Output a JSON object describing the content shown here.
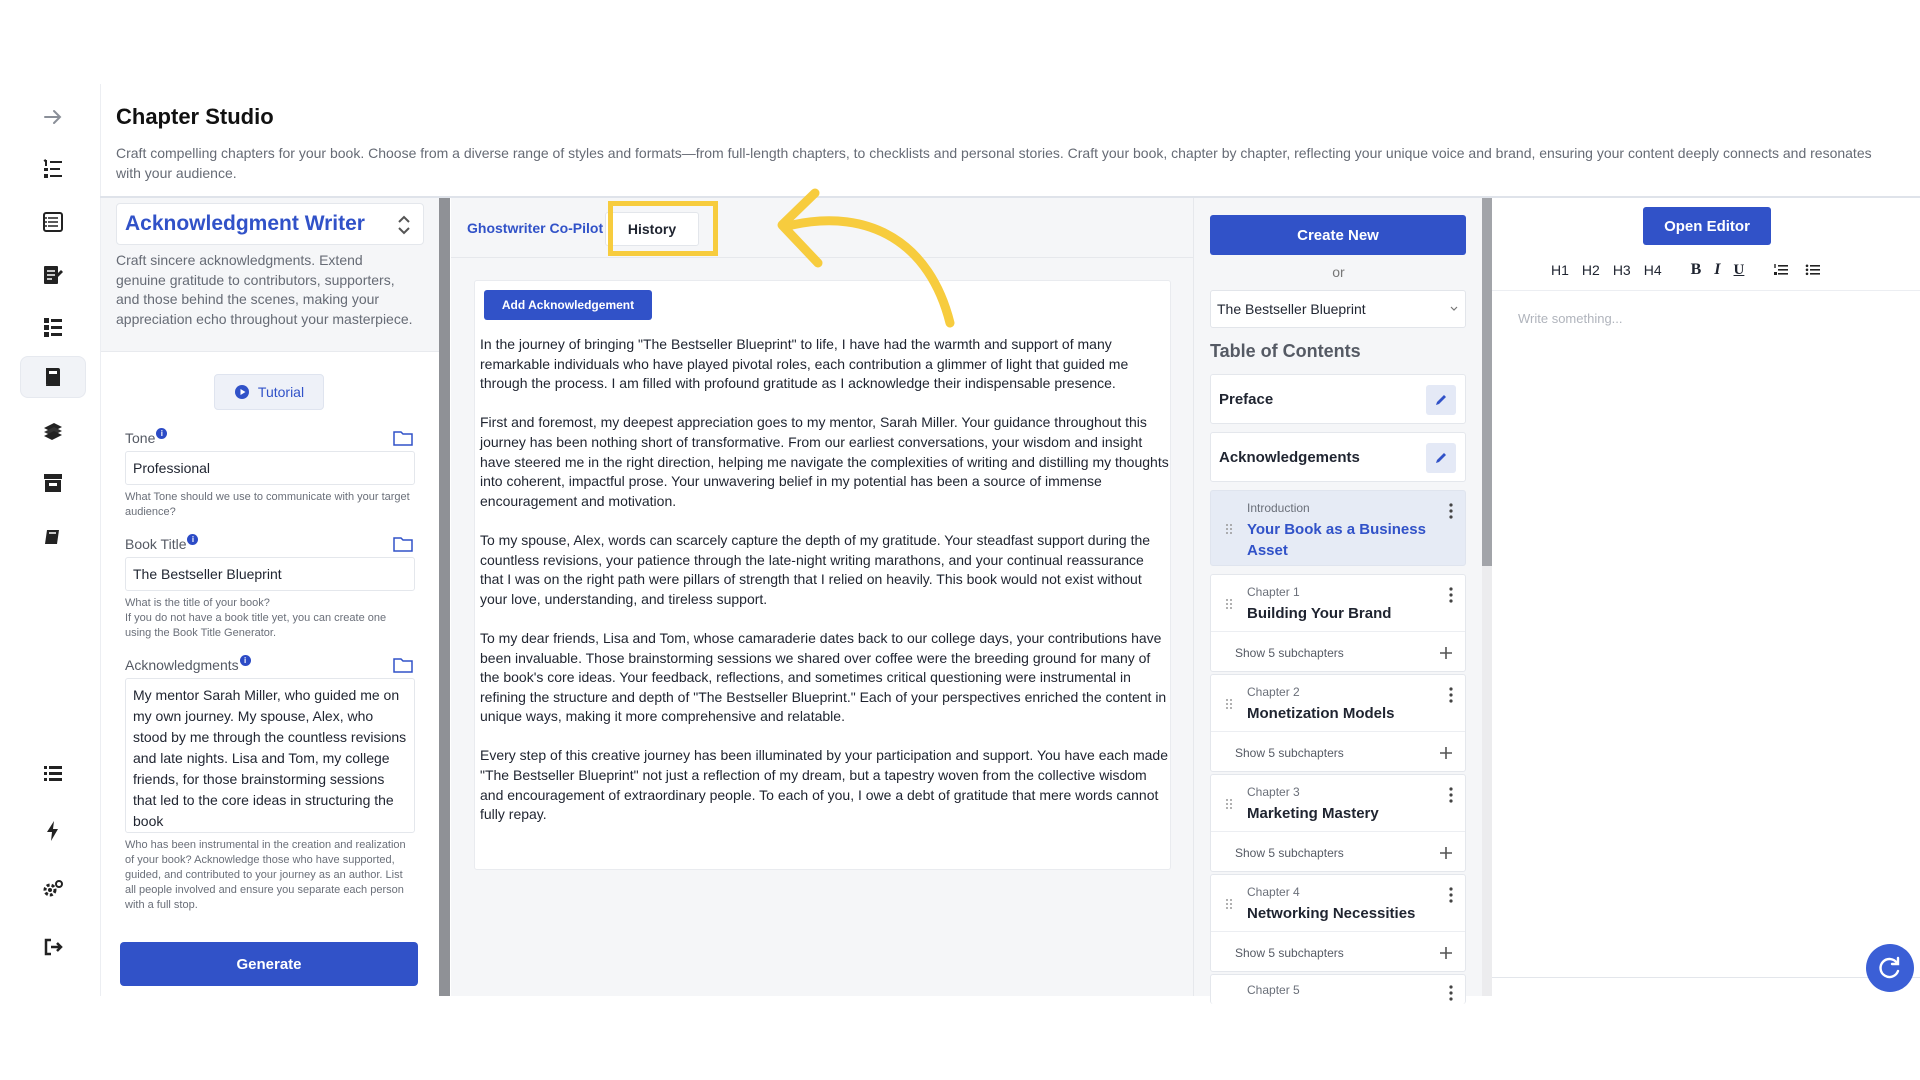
{
  "page": {
    "title": "Chapter Studio",
    "description": "Craft compelling chapters for your book. Choose from a diverse range of styles and formats—from full-length chapters, to checklists and personal stories. Craft your book, chapter by chapter, reflecting your unique voice and brand, ensuring your content deeply connects and resonates with your audience."
  },
  "sidebar": {
    "icons": [
      "arrow-right-icon",
      "numbered-list-icon",
      "book-layout-icon",
      "document-edit-icon",
      "checklist-icon",
      "book-active-icon",
      "books-stack-icon",
      "archive-icon",
      "book-small-icon",
      "list-icon",
      "lightning-icon",
      "settings-icon",
      "logout-icon"
    ]
  },
  "config": {
    "writer": "Acknowledgment Writer",
    "writer_desc": "Craft sincere acknowledgments. Extend genuine gratitude to contributors, supporters, and those behind the scenes, making your appreciation echo throughout your masterpiece.",
    "tutorial": "Tutorial",
    "tone_label": "Tone",
    "tone_value": "Professional",
    "tone_help": "What Tone should we use to communicate with your target audience?",
    "title_label": "Book Title",
    "title_value": "The Bestseller Blueprint",
    "title_help": "What is the title of your book?\nIf you do not have a book title yet, you can create one using the Book Title Generator.",
    "ack_label": "Acknowledgments",
    "ack_value": "My mentor Sarah Miller, who guided me on my own journey. My spouse, Alex, who stood by me through the countless revisions and late nights. Lisa and Tom, my college friends, for those brainstorming sessions that led to the core ideas in structuring the book",
    "ack_help": "Who has been instrumental in the creation and realization of your book? Acknowledge those who have supported, guided, and contributed to your journey as an author. List all people involved and ensure you separate each person with a full stop.",
    "generate": "Generate"
  },
  "middle": {
    "tab_copilot": "Ghostwriter Co-Pilot",
    "tab_history": "History",
    "add_button": "Add Acknowledgement",
    "paragraphs": [
      "In the journey of bringing \"The Bestseller Blueprint\" to life, I have had the warmth and support of many remarkable individuals who have played pivotal roles, each contribution a glimmer of light that guided me through the process. I am filled with profound gratitude as I acknowledge their indispensable presence.",
      "First and foremost, my deepest appreciation goes to my mentor, Sarah Miller. Your guidance throughout this journey has been nothing short of transformative. From our earliest conversations, your wisdom and insight have steered me in the right direction, helping me navigate the complexities of writing and distilling my thoughts into coherent, impactful prose. Your unwavering belief in my potential has been a source of immense encouragement and motivation.",
      "To my spouse, Alex, words can scarcely capture the depth of my gratitude. Your steadfast support during the countless revisions, your patience through the late-night writing marathons, and your continual reassurance that I was on the right path were pillars of strength that I relied on heavily. This book would not exist without your love, understanding, and tireless support.",
      "To my dear friends, Lisa and Tom, whose camaraderie dates back to our college days, your contributions have been invaluable. Those brainstorming sessions we shared over coffee were the breeding ground for many of the book's core ideas. Your feedback, reflections, and sometimes critical questioning were instrumental in refining the structure and depth of \"The Bestseller Blueprint.\" Each of your perspectives enriched the content in unique ways, making it more comprehensive and relatable.",
      "Every step of this creative journey has been illuminated by your participation and support. You have each made \"The Bestseller Blueprint\" not just a reflection of my dream, but a tapestry woven from the collective wisdom and encouragement of extraordinary people. To each of you, I owe a debt of gratitude that mere words cannot fully repay."
    ]
  },
  "toc": {
    "create_new": "Create New",
    "or": "or",
    "book": "The Bestseller Blueprint",
    "heading": "Table of Contents",
    "simple": [
      "Preface",
      "Acknowledgements"
    ],
    "chapters": [
      {
        "kicker": "Introduction",
        "title": "Your Book as a Business Asset",
        "sub": ""
      },
      {
        "kicker": "Chapter 1",
        "title": "Building Your Brand",
        "sub": "Show 5 subchapters"
      },
      {
        "kicker": "Chapter 2",
        "title": "Monetization Models",
        "sub": "Show 5 subchapters"
      },
      {
        "kicker": "Chapter 3",
        "title": "Marketing Mastery",
        "sub": "Show 5 subchapters"
      },
      {
        "kicker": "Chapter 4",
        "title": "Networking Necessities",
        "sub": "Show 5 subchapters"
      },
      {
        "kicker": "Chapter 5",
        "title": "",
        "sub": ""
      }
    ]
  },
  "editor": {
    "open_editor": "Open Editor",
    "headings": [
      "H1",
      "H2",
      "H3",
      "H4"
    ],
    "format": [
      "B",
      "I",
      "U"
    ],
    "placeholder": "Write something..."
  },
  "colors": {
    "primary": "#3152c8",
    "annotation": "#f7cc3e"
  }
}
